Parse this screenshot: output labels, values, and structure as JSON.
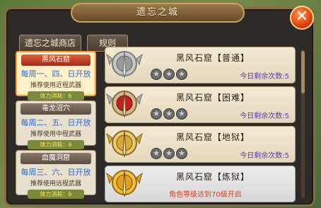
{
  "window": {
    "title": "遗忘之城",
    "close_label": "✕"
  },
  "tabs": {
    "shop": "遗忘之城商店",
    "rules": "规则"
  },
  "sidebar": [
    {
      "name": "黑风石窟",
      "days": "每周一、四、日开放",
      "weapon": "推荐使用近程武器",
      "stamina": "体力消耗：6",
      "active": true
    },
    {
      "name": "毒龙沼穴",
      "days": "每周二、五、日开放",
      "weapon": "推荐使用中程武器",
      "stamina": "体力消耗：6",
      "active": false
    },
    {
      "name": "血魔洞窟",
      "days": "每周三、六、日开放",
      "weapon": "推荐使用远程武器",
      "stamina": "体力消耗：6",
      "active": false
    }
  ],
  "levels": [
    {
      "title": "黑风石窟【普通】",
      "stars": 3,
      "remaining": "今日剩余次数:5",
      "locked": false
    },
    {
      "title": "黑风石窟【困难】",
      "stars": 3,
      "remaining": "今日剩余次数:5",
      "locked": false
    },
    {
      "title": "黑风石窟【地狱】",
      "stars": 3,
      "remaining": "今日剩余次数:5",
      "locked": false
    },
    {
      "title": "黑风石窟【炼狱】",
      "stars": 0,
      "locked_text": "角色等级达到70级开启",
      "locked": true
    }
  ],
  "colors": {
    "accent": "#ff9a30",
    "remaining_text": "#5a3ab0",
    "locked_text": "#e0401a"
  }
}
